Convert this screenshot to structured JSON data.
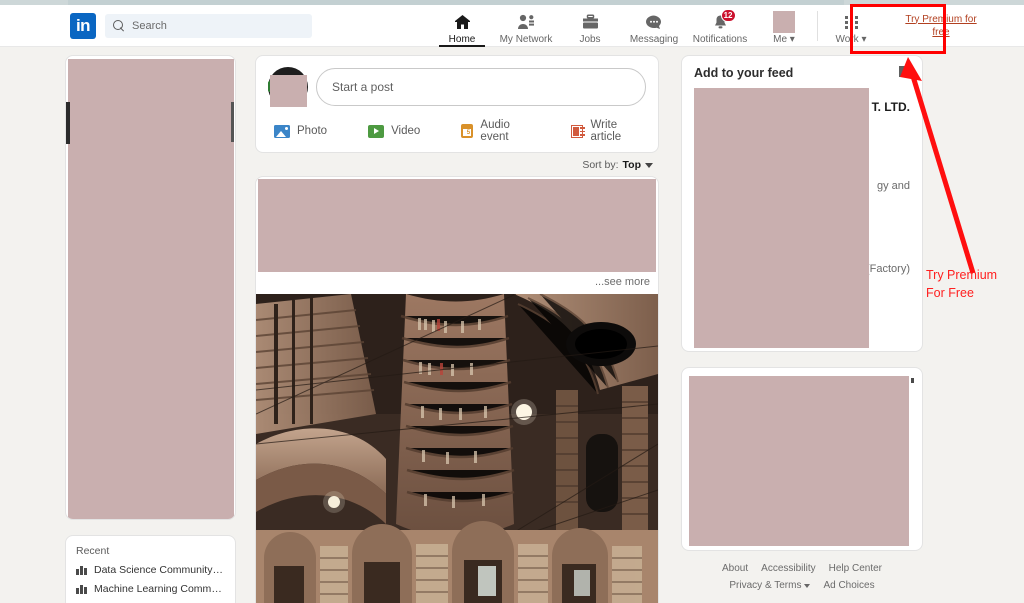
{
  "navbar": {
    "logo_text": "in",
    "logo_icon": "linkedin-logo",
    "search": {
      "icon": "search-icon",
      "placeholder": "Search",
      "value": ""
    },
    "items": [
      {
        "label": "Home",
        "icon": "home-icon",
        "active": true
      },
      {
        "label": "My Network",
        "icon": "people-icon",
        "active": false
      },
      {
        "label": "Jobs",
        "icon": "briefcase-icon",
        "active": false
      },
      {
        "label": "Messaging",
        "icon": "chat-bubble-icon",
        "active": false
      },
      {
        "label": "Notifications",
        "icon": "bell-icon",
        "active": false,
        "badge": "12"
      },
      {
        "label": "Me ▾",
        "icon": "avatar-redacted",
        "active": false
      },
      {
        "label": "Work ▾",
        "icon": "grid-apps-icon",
        "active": false
      }
    ],
    "premium_link": "Try Premium for free"
  },
  "annotation": {
    "label": "Try Premium\nFor Free",
    "label_line1": "Try Premium",
    "label_line2": "For Free",
    "box_color": "#ff0000",
    "arrow_color": "#ff2020"
  },
  "sidebar_left": {
    "profile_card": {
      "redacted": true
    },
    "recent": {
      "title": "Recent",
      "items": [
        {
          "label": "Data Science Community (mo...",
          "icon": "group-icon"
        },
        {
          "label": "Machine Learning Community ...",
          "icon": "group-icon"
        }
      ]
    }
  },
  "composer": {
    "placeholder": "Start a post",
    "actions": [
      {
        "label": "Photo",
        "icon": "photo-icon",
        "color": "#3b85c8"
      },
      {
        "label": "Video",
        "icon": "video-icon",
        "color": "#4d9a41"
      },
      {
        "label": "Audio event",
        "icon": "calendar-audio-icon",
        "color": "#d9912a"
      },
      {
        "label": "Write article",
        "icon": "article-icon",
        "color": "#d15a3e"
      }
    ]
  },
  "feed": {
    "sort_by_label": "Sort by:",
    "sort_by_value": "Top",
    "post": {
      "text_redacted": true,
      "see_more": "...see more",
      "image_alt": "library-interior-photo"
    }
  },
  "sidebar_right": {
    "add_to_feed": {
      "title": "Add to your feed",
      "info_icon": "info-icon",
      "partial_text_1": "T. LTD.",
      "partial_text_2": "gy and",
      "partial_text_3": "(Factory)",
      "redacted": true
    },
    "promo_card": {
      "redacted": true
    },
    "footer": {
      "row1": [
        "About",
        "Accessibility",
        "Help Center"
      ],
      "row2": [
        "Privacy & Terms",
        "Ad Choices"
      ]
    }
  },
  "colors": {
    "brand": "#0a66c2",
    "page_bg": "#f3f2ef",
    "redaction": "#c9afaf",
    "badge_red": "#cb112d",
    "annotation_red": "#ff0000",
    "premium_link": "#b24020"
  }
}
